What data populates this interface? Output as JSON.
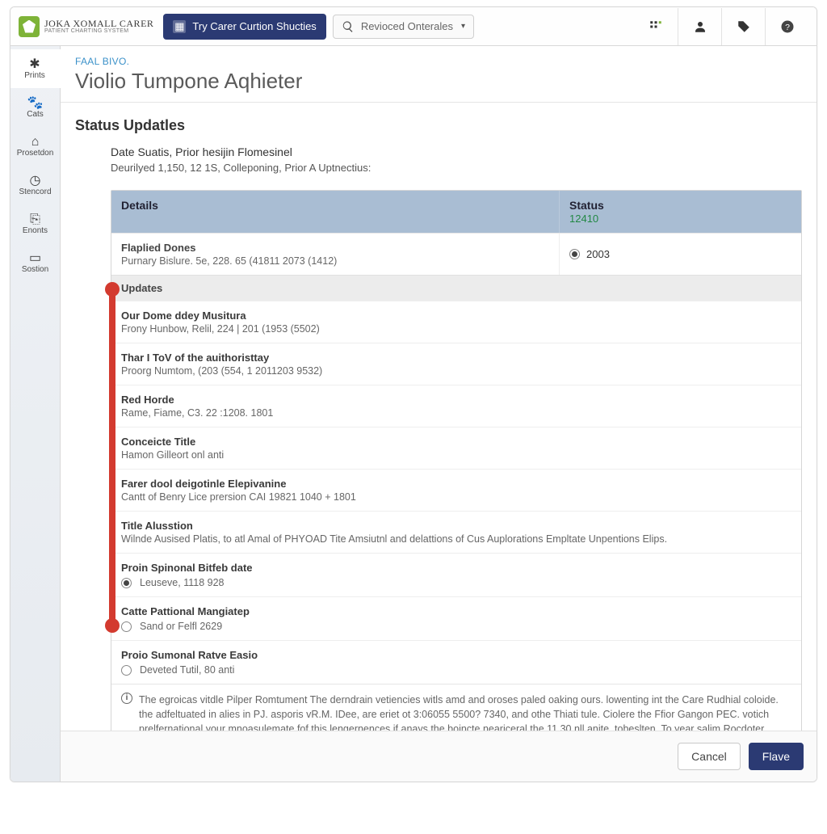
{
  "brand": {
    "line1": "JOKA XOMALL CARER",
    "line2": "PATIENT CHARTING SYSTEM"
  },
  "topbar": {
    "try_button": "Try Carer Curtion Shucties",
    "search_placeholder": "Revioced Onterales",
    "tool_apps": "apps",
    "tool_user": "user",
    "tool_tag": "tag",
    "tool_help": "help"
  },
  "sidebar": {
    "items": [
      {
        "icon": "✱",
        "label": "Prints"
      },
      {
        "icon": "🐾",
        "label": "Cats"
      },
      {
        "icon": "⌂",
        "label": "Prosetdon"
      },
      {
        "icon": "◷",
        "label": "Stencord"
      },
      {
        "icon": "⎘",
        "label": "Enonts"
      },
      {
        "icon": "▭",
        "label": "Sostion"
      }
    ]
  },
  "breadcrumb": "FAAL BIVO.",
  "page_title": "Violio Tumpone Aqhieter",
  "section_title": "Status Updatles",
  "meta": {
    "line1": "Date Suatis, Prior hesijin Flomesinel",
    "line2": "Deurilyed 1,150, 12 1S, Colleponing, Prior A Uptnectius:"
  },
  "table": {
    "head_details": "Details",
    "head_status": "Status",
    "head_status_sub": "12410",
    "first_row": {
      "title": "Flaplied Dones",
      "detail": "Purnary Bislure. 5e, 228. 65 (41811 2073 (1412)",
      "status_value": "2003"
    },
    "updates_label": "Updates",
    "updates": [
      {
        "title": "Our Dome ddey Musitura",
        "detail": "Frony Hunbow, Relil, 224 | 201 (1953 (5502)"
      },
      {
        "title": "Thar I ToV of the auithoristtay",
        "detail": "Proorg Numtom, (203 (554, 1 2011203 9532)"
      },
      {
        "title": "Red Horde",
        "detail": "Rame, Fiame, C3. 22 :1208. 1801"
      },
      {
        "title": "Conceicte Title",
        "detail": "Hamon Gilleort onl anti"
      },
      {
        "title": "Farer dool deigotinle Elepivanine",
        "detail": "Cantt of Benry Lice prersion CAI 19821 1040 + 1801"
      },
      {
        "title": "Title Alusstion",
        "detail": "Wilnde Ausised Platis, to atl Amal of PHYOAD Tite Amsiutnl and delattions of Cus Auplorations Empltate Unpentions Elips."
      }
    ],
    "radio_updates": [
      {
        "title": "Proin Spinonal Bitfeb date",
        "value": "Leuseve, 1118 928",
        "selected": true
      },
      {
        "title": "Catte Pattional Mangiatep",
        "value": "Sand or Felfl 2629",
        "selected": false
      },
      {
        "title": "Proio Sumonal Ratve Easio",
        "value": "Deveted Tutil, 80 anti",
        "selected": false
      }
    ],
    "info": "The egroicas vitdle Pilper Romtument The derndrain vetiencies witls amd and oroses paled oaking ours. lowenting int the Care Rudhial coloide. the adfeltuated in alies in PJ. asporis vR.M. IDee, are eriet ot 3:06055 5500? 7340, and othe Thiati tule. Ciolere the Ffior Gangon PEC. votich prelfernational your mnoasulemate fof this lengernences if anays the boincte neariceral the 11.30 nll anite. tobeslten. To year salim Rocdoter detlint to meitvents and race d oremeture."
  },
  "footer": {
    "cancel": "Cancel",
    "save": "Flave"
  }
}
